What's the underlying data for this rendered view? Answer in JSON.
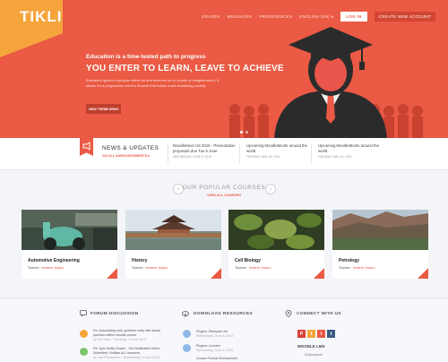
{
  "brand": {
    "logo": "TIKLI"
  },
  "nav": {
    "items": [
      "GRADES",
      "MESSAGES",
      "PREFERENCES",
      "ENGLISH (EN) ▾"
    ],
    "login": "LOG IN",
    "create": "CREATE NEW ACCOUNT"
  },
  "hero": {
    "kicker": "Education is a time-tested path to progress",
    "title": "YOU ENTER TO LEARN, LEAVE TO ACHIEVE",
    "desc": "Education ignites a purpose within us and beckons us on a path of enlightenment. It allows for a progressive mind to flourish that builds a self-sustaining society.",
    "button": "VIEW THEME DEMO",
    "colors": {
      "bg": "#ea5a44",
      "accent": "#f5a53c"
    }
  },
  "news": {
    "title": "NEWS & UPDATES",
    "link": "GO ALL ANNOUNCEMENTS ▸",
    "items": [
      {
        "title": "MoodleMoot US 2015 - Presentation proposals due Tue 5 June",
        "date": "WEDNESDAY, JUNE 3, 2015"
      },
      {
        "title": "Upcoming MoodleMoots around the world",
        "date": "TUESDAY, MAY 19, 2015"
      },
      {
        "title": "Upcoming MoodleMoots around the world",
        "date": "TUESDAY, MAY 19, 2015"
      }
    ]
  },
  "courses": {
    "title": "OUR POPULAR COURSES",
    "link": "VIEW ALL COURSES",
    "teacher_label": "Teacher :",
    "items": [
      {
        "name": "Automotive Engineering",
        "teacher": "Heather Mayes",
        "image": "scooter-photo"
      },
      {
        "name": "History",
        "teacher": "Heather Mayes",
        "image": "pagoda-photo"
      },
      {
        "name": "Cell Biology",
        "teacher": "Heather Mayes",
        "image": "leaves-photo"
      },
      {
        "name": "Petrology",
        "teacher": "Heather Mayes",
        "image": "canyon-photo"
      }
    ]
  },
  "footer": {
    "forum": {
      "title": "FORUM DISCUSSION",
      "items": [
        {
          "text": "Re: Associating moll_question entry with actual question within moodle course",
          "meta": "by Tim Hunt - Thursday, 4 June 2015"
        },
        {
          "text": "Re: Quiz Notify Grader - Get Notification When Submitted. Notifies ALL teachers",
          "meta": "by Lisa Richardson - Wednesday, 3 June 2015"
        }
      ]
    },
    "downloads": {
      "title": "DOWNLOAD RESOURCES",
      "items": [
        {
          "text": "Plugins: Etherpad Lite",
          "meta": "Wednesday, June 3, 2015"
        },
        {
          "text": "Plugins: Lecturer",
          "meta": "Wednesday, June 3, 2015"
        },
        {
          "text": "Course Format Development",
          "meta": ""
        }
      ]
    },
    "connect": {
      "title": "CONNECT WITH US",
      "social": [
        "P",
        "f",
        "t",
        "t"
      ],
      "org": "MOODLE LMS",
      "address": "Schlumsauer"
    }
  }
}
